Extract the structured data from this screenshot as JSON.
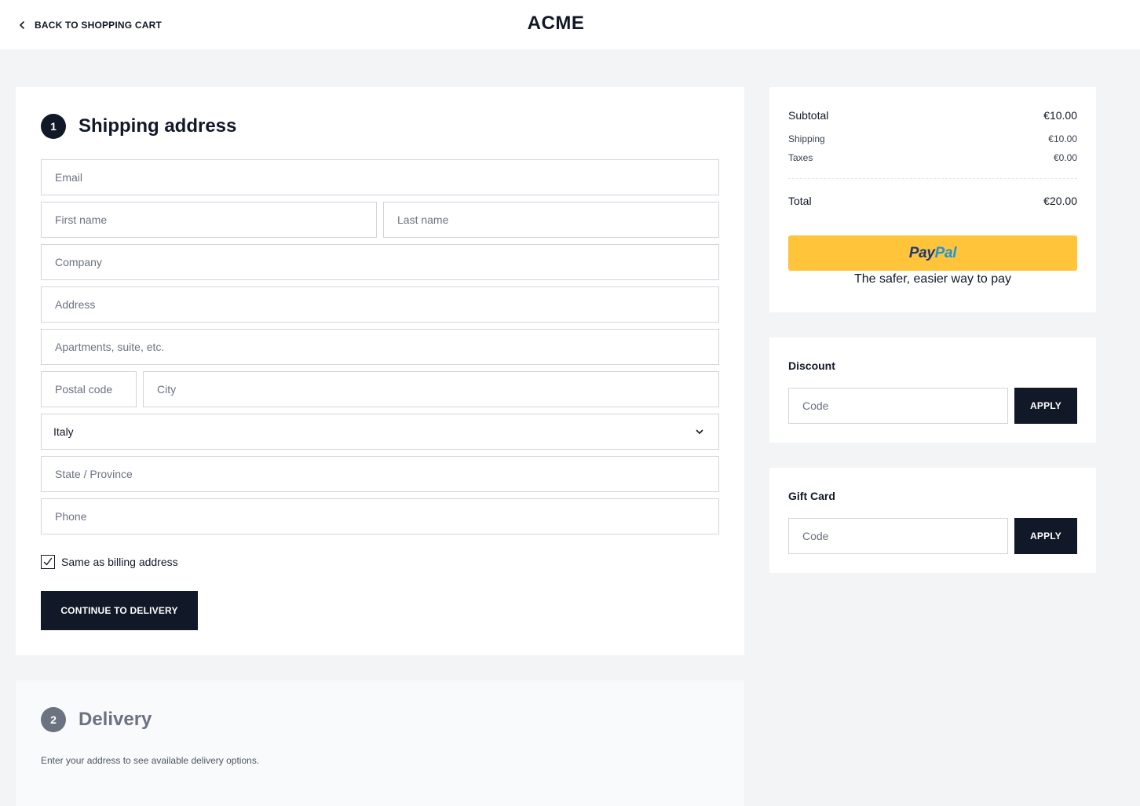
{
  "header": {
    "back_label": "BACK TO SHOPPING CART",
    "logo": "ACME"
  },
  "shipping": {
    "step_number": "1",
    "title": "Shipping address",
    "fields": {
      "email": "Email",
      "first_name": "First name",
      "last_name": "Last name",
      "company": "Company",
      "address": "Address",
      "apartment": "Apartments, suite, etc.",
      "postal_code": "Postal code",
      "city": "City",
      "state": "State / Province",
      "phone": "Phone"
    },
    "country": "Italy",
    "same_as_billing_label": "Same as billing address",
    "same_as_billing_checked": true,
    "continue_label": "CONTINUE TO DELIVERY"
  },
  "delivery": {
    "step_number": "2",
    "title": "Delivery",
    "hint": "Enter your address to see available delivery options."
  },
  "summary": {
    "subtotal_label": "Subtotal",
    "subtotal_value": "€10.00",
    "shipping_label": "Shipping",
    "shipping_value": "€10.00",
    "taxes_label": "Taxes",
    "taxes_value": "€0.00",
    "total_label": "Total",
    "total_value": "€20.00",
    "paypal_pay": "Pay",
    "paypal_pal": "Pal",
    "paypal_tagline": "The safer, easier way to pay"
  },
  "discount": {
    "title": "Discount",
    "placeholder": "Code",
    "apply_label": "APPLY"
  },
  "gift_card": {
    "title": "Gift Card",
    "placeholder": "Code",
    "apply_label": "APPLY"
  },
  "colors": {
    "primary": "#111827",
    "page_bg": "#f3f4f6",
    "paypal_yellow": "#ffc43a",
    "paypal_dark_blue": "#1b3a7a",
    "paypal_light_blue": "#1f94d6"
  },
  "icons": {
    "back": "chevron-left-icon",
    "select": "chevron-down-icon",
    "checkbox": "checkmark-icon"
  }
}
